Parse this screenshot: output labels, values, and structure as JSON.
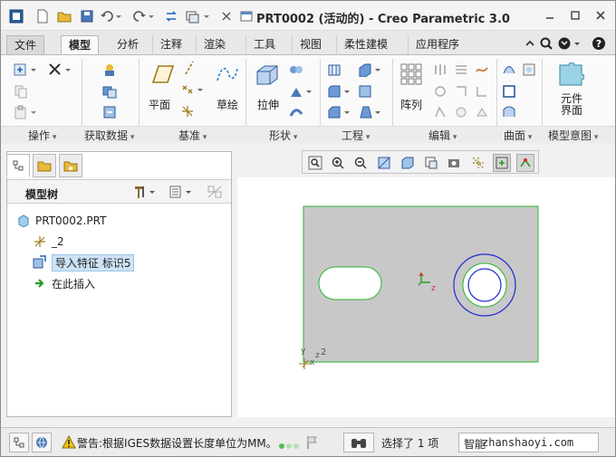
{
  "window": {
    "title": "PRT0002 (活动的) - Creo Parametric 3.0"
  },
  "ribbon_tabs": [
    "文件",
    "模型",
    "分析",
    "注释",
    "渲染",
    "工具",
    "视图",
    "柔性建模",
    "应用程序"
  ],
  "ribbon": {
    "groups": {
      "operations": "操作",
      "get_data": "获取数据",
      "datum": "基准",
      "shapes": "形状",
      "engineering": "工程",
      "editing": "编辑",
      "surfaces": "曲面",
      "model_intent": "模型意图"
    },
    "buttons": {
      "plane": "平面",
      "sketch": "草绘",
      "extrude": "拉伸",
      "pattern": "阵列",
      "component_interface": "元件\n界面"
    }
  },
  "model_tree": {
    "title": "模型树",
    "items": [
      {
        "label": "PRT0002.PRT",
        "icon": "part-icon"
      },
      {
        "label": "_2",
        "icon": "csys-icon"
      },
      {
        "label": "导入特征 标识5",
        "icon": "import-feature-icon"
      },
      {
        "label": "在此插入",
        "icon": "insert-here-arrow-icon"
      }
    ]
  },
  "canvas": {
    "csys_label_main": "z",
    "csys_corner_x": "x",
    "csys_corner_y": "y",
    "csys_corner_z": "z",
    "csys_corner_num": "2"
  },
  "status": {
    "warning": "警告:根据IGES数据设置长度单位为MM。",
    "selection": "选择了 1 项",
    "filter": "智能"
  },
  "watermark": "zhanshaoyi.com",
  "colors": {
    "part_fill": "#c8c8c8",
    "edge": "#2db52d",
    "hole": "#1f2bd0",
    "selection": "#cde3f7"
  }
}
